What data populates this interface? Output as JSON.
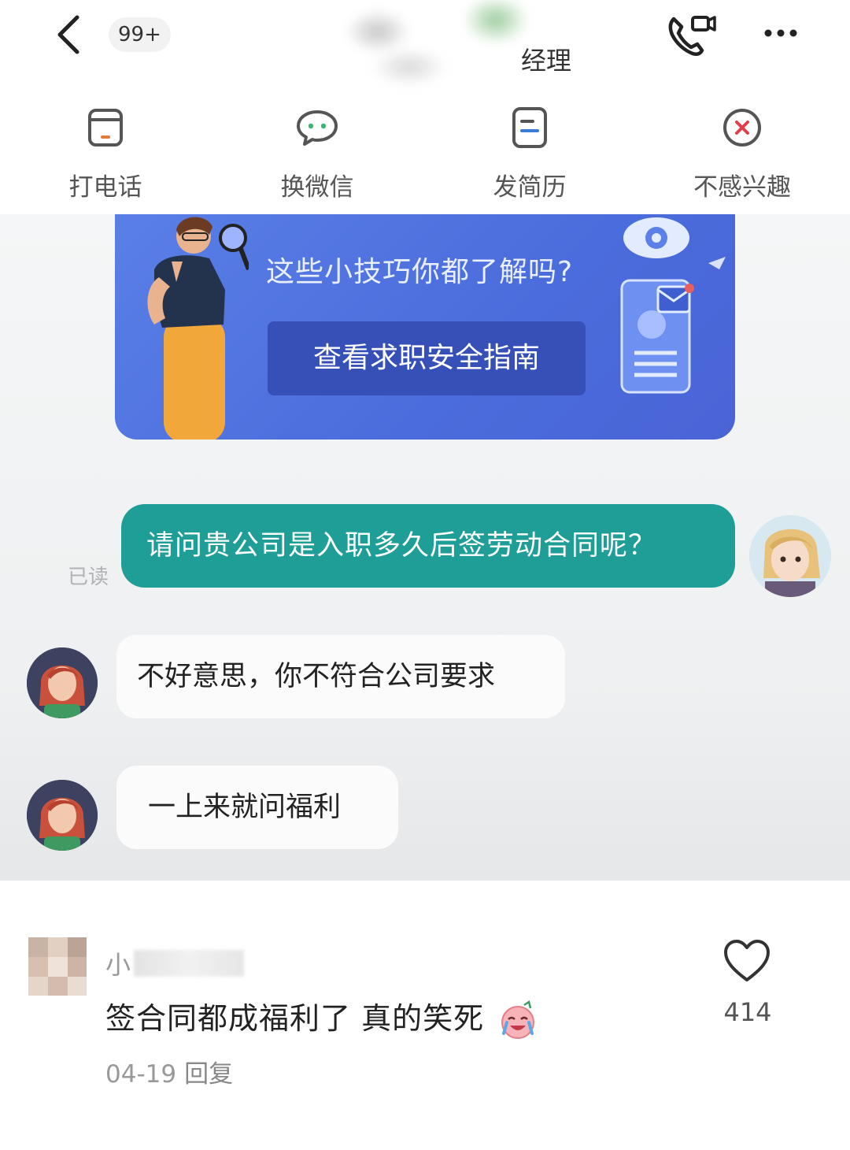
{
  "header": {
    "unread_badge": "99+",
    "title_suffix": "经理"
  },
  "actions": [
    {
      "label": "打电话",
      "icon": "phone-card-icon"
    },
    {
      "label": "换微信",
      "icon": "wechat-chat-icon"
    },
    {
      "label": "发简历",
      "icon": "resume-icon"
    },
    {
      "label": "不感兴趣",
      "icon": "close-circle-icon"
    }
  ],
  "banner": {
    "question": "这些小技巧你都了解吗?",
    "button_label": "查看求职安全指南"
  },
  "messages": {
    "outgoing": {
      "text": "请问贵公司是入职多久后签劳动合同呢？",
      "status": "已读"
    },
    "incoming": [
      {
        "text": "不好意思，你不符合公司要求"
      },
      {
        "text": "一上来就问福利"
      }
    ]
  },
  "comment": {
    "author_visible": "小",
    "text": "签合同都成福利了 真的笑死",
    "date": "04-19",
    "reply_label": "回复",
    "likes": "414"
  },
  "colors": {
    "outgoing_bubble": "#1e9e97",
    "banner_bg": "#5a7fe6",
    "banner_button": "#3650b8",
    "close_accent": "#e0404b"
  }
}
